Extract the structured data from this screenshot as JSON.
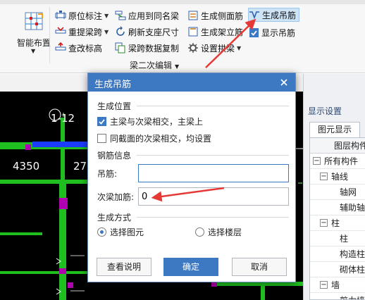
{
  "ribbon": {
    "smart_layout_label": "智能布置",
    "col1": [
      "原位标注",
      "重提梁跨",
      "查改标高"
    ],
    "col2": [
      "应用到同名梁",
      "刷新支座尺寸",
      "梁跨数据复制"
    ],
    "col3": [
      "生成侧面筋",
      "生成架立筋",
      "设置拱梁"
    ],
    "col4": [
      "生成吊筋",
      "显示吊筋"
    ],
    "group_label": "梁二次编辑"
  },
  "canvas": {
    "axis_label": "1-12",
    "dim_left": "4350",
    "dim_right": "27"
  },
  "right_panel": {
    "header": "显示设置",
    "tab": "图元显示",
    "tree_header": "图层构件",
    "tree_items": [
      "所有构件",
      "轴线",
      "轴网",
      "辅助轴线",
      "柱",
      "柱",
      "构造柱",
      "砌体柱",
      "墙",
      "剪力墙"
    ]
  },
  "dialog": {
    "title": "生成吊筋",
    "section_position": "生成位置",
    "opt_main_secondary": "主梁与次梁相交，主梁上",
    "opt_same_section": "同截面的次梁相交，均设置",
    "section_rebar": "钢筋信息",
    "hanger_label": "吊筋:",
    "hanger_value": "",
    "secondary_label": "次梁加筋:",
    "secondary_value": "0",
    "section_method": "生成方式",
    "radio_select_element": "选择图元",
    "radio_select_floor": "选择楼层",
    "btn_help": "查看说明",
    "btn_ok": "确定",
    "btn_cancel": "取消"
  },
  "colors": {
    "accent": "#3d79c2",
    "annotation_arrow": "#e53935",
    "cad_green": "#1fbf1f",
    "cad_magenta": "#b000b0",
    "cad_blue": "#1b3cff"
  }
}
